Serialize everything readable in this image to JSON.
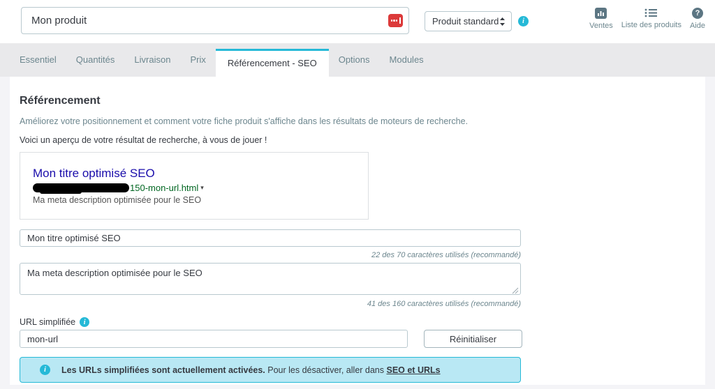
{
  "header": {
    "product_name": "Mon produit",
    "product_type_selected": "Produit standard",
    "actions": [
      {
        "icon": "bar-chart-icon",
        "label": "Ventes"
      },
      {
        "icon": "list-icon",
        "label": "Liste des produits"
      },
      {
        "icon": "question-icon",
        "label": "Aide"
      }
    ]
  },
  "tabs": {
    "items": [
      {
        "label": "Essentiel"
      },
      {
        "label": "Quantités"
      },
      {
        "label": "Livraison"
      },
      {
        "label": "Prix"
      },
      {
        "label": "Référencement - SEO"
      },
      {
        "label": "Options"
      },
      {
        "label": "Modules"
      }
    ],
    "active": "Référencement - SEO"
  },
  "seo": {
    "section_title": "Référencement",
    "intro": "Améliorez votre positionnement et comment votre fiche produit s'affiche dans les résultats de moteurs de recherche.",
    "preview_hint": "Voici un aperçu de votre résultat de recherche, à vous de jouer !",
    "serp": {
      "title": "Mon titre optimisé SEO",
      "url_visible_suffix": "150-mon-url.html",
      "caret": "▾",
      "description": "Ma meta description optimisée pour le SEO"
    },
    "meta_title": {
      "value": "Mon titre optimisé SEO",
      "counter": "22 des 70 caractères utilisés (recommandé)"
    },
    "meta_description": {
      "value": "Ma meta description optimisée pour le SEO",
      "counter": "41 des 160 caractères utilisés (recommandé)"
    },
    "friendly_url": {
      "label": "URL simplifiée",
      "value": "mon-url",
      "reset_label": "Réinitialiser"
    },
    "alert": {
      "bold": "Les URLs simplifiées sont actuellement activées.",
      "rest": " Pour les désactiver, aller dans ",
      "link": "SEO et URLs"
    }
  },
  "colors": {
    "accent_cyan": "#25b9d7",
    "serp_title_blue": "#1a0dab",
    "serp_url_green": "#006621",
    "alert_bg": "#b9e8f4",
    "flag_red": "#dc3a3a",
    "tabbar_bg": "#e9e9eb",
    "page_bg": "#f4f4f7"
  }
}
